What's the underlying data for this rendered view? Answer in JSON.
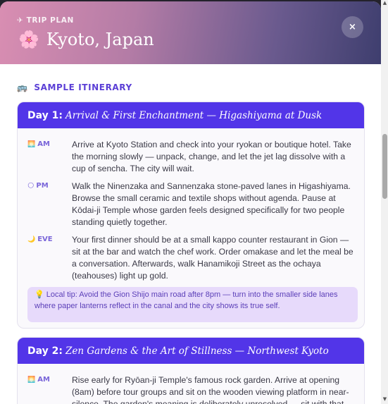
{
  "header": {
    "eyebrow_icon": "✈",
    "eyebrow": "TRIP PLAN",
    "title_icon": "🌸",
    "title": "Kyoto, Japan",
    "close_label": "×"
  },
  "itinerary": {
    "heading_icon": "🚌",
    "heading": "SAMPLE ITINERARY",
    "days": [
      {
        "label": "Day 1:",
        "title": "Arrival & First Enchantment — Higashiyama at Dusk",
        "slots": [
          {
            "icon": "🌅",
            "tag": "AM",
            "text": "Arrive at Kyoto Station and check into your ryokan or boutique hotel. Take the morning slowly — unpack, change, and let the jet lag dissolve with a cup of sencha. The city will wait."
          },
          {
            "icon": "🌕",
            "tag": "PM",
            "text": "Walk the Ninenzaka and Sannenzaka stone-paved lanes in Higashiyama. Browse the small ceramic and textile shops without agenda. Pause at Kōdai-ji Temple whose garden feels designed specifically for two people standing quietly together."
          },
          {
            "icon": "🌙",
            "tag": "EVE",
            "text": "Your first dinner should be at a small kappo counter restaurant in Gion — sit at the bar and watch the chef work. Order omakase and let the meal be a conversation. Afterwards, walk Hanamikoji Street as the ochaya (teahouses) light up gold."
          }
        ],
        "tip_icon": "💡",
        "tip": "Local tip: Avoid the Gion Shijo main road after 8pm — turn into the smaller side lanes where paper lanterns reflect in the canal and the city shows its true self."
      },
      {
        "label": "Day 2:",
        "title": "Zen Gardens & the Art of Stillness — Northwest Kyoto",
        "slots": [
          {
            "icon": "🌅",
            "tag": "AM",
            "text": "Rise early for Ryōan-ji Temple's famous rock garden. Arrive at opening (8am) before tour groups and sit on the wooden viewing platform in near-silence. The garden's meaning is deliberately unresolved — sit with that together."
          }
        ]
      }
    ]
  },
  "colors": {
    "accent": "#5235e8",
    "heading": "#5b3fd6",
    "tip_bg": "#e7dafb"
  }
}
